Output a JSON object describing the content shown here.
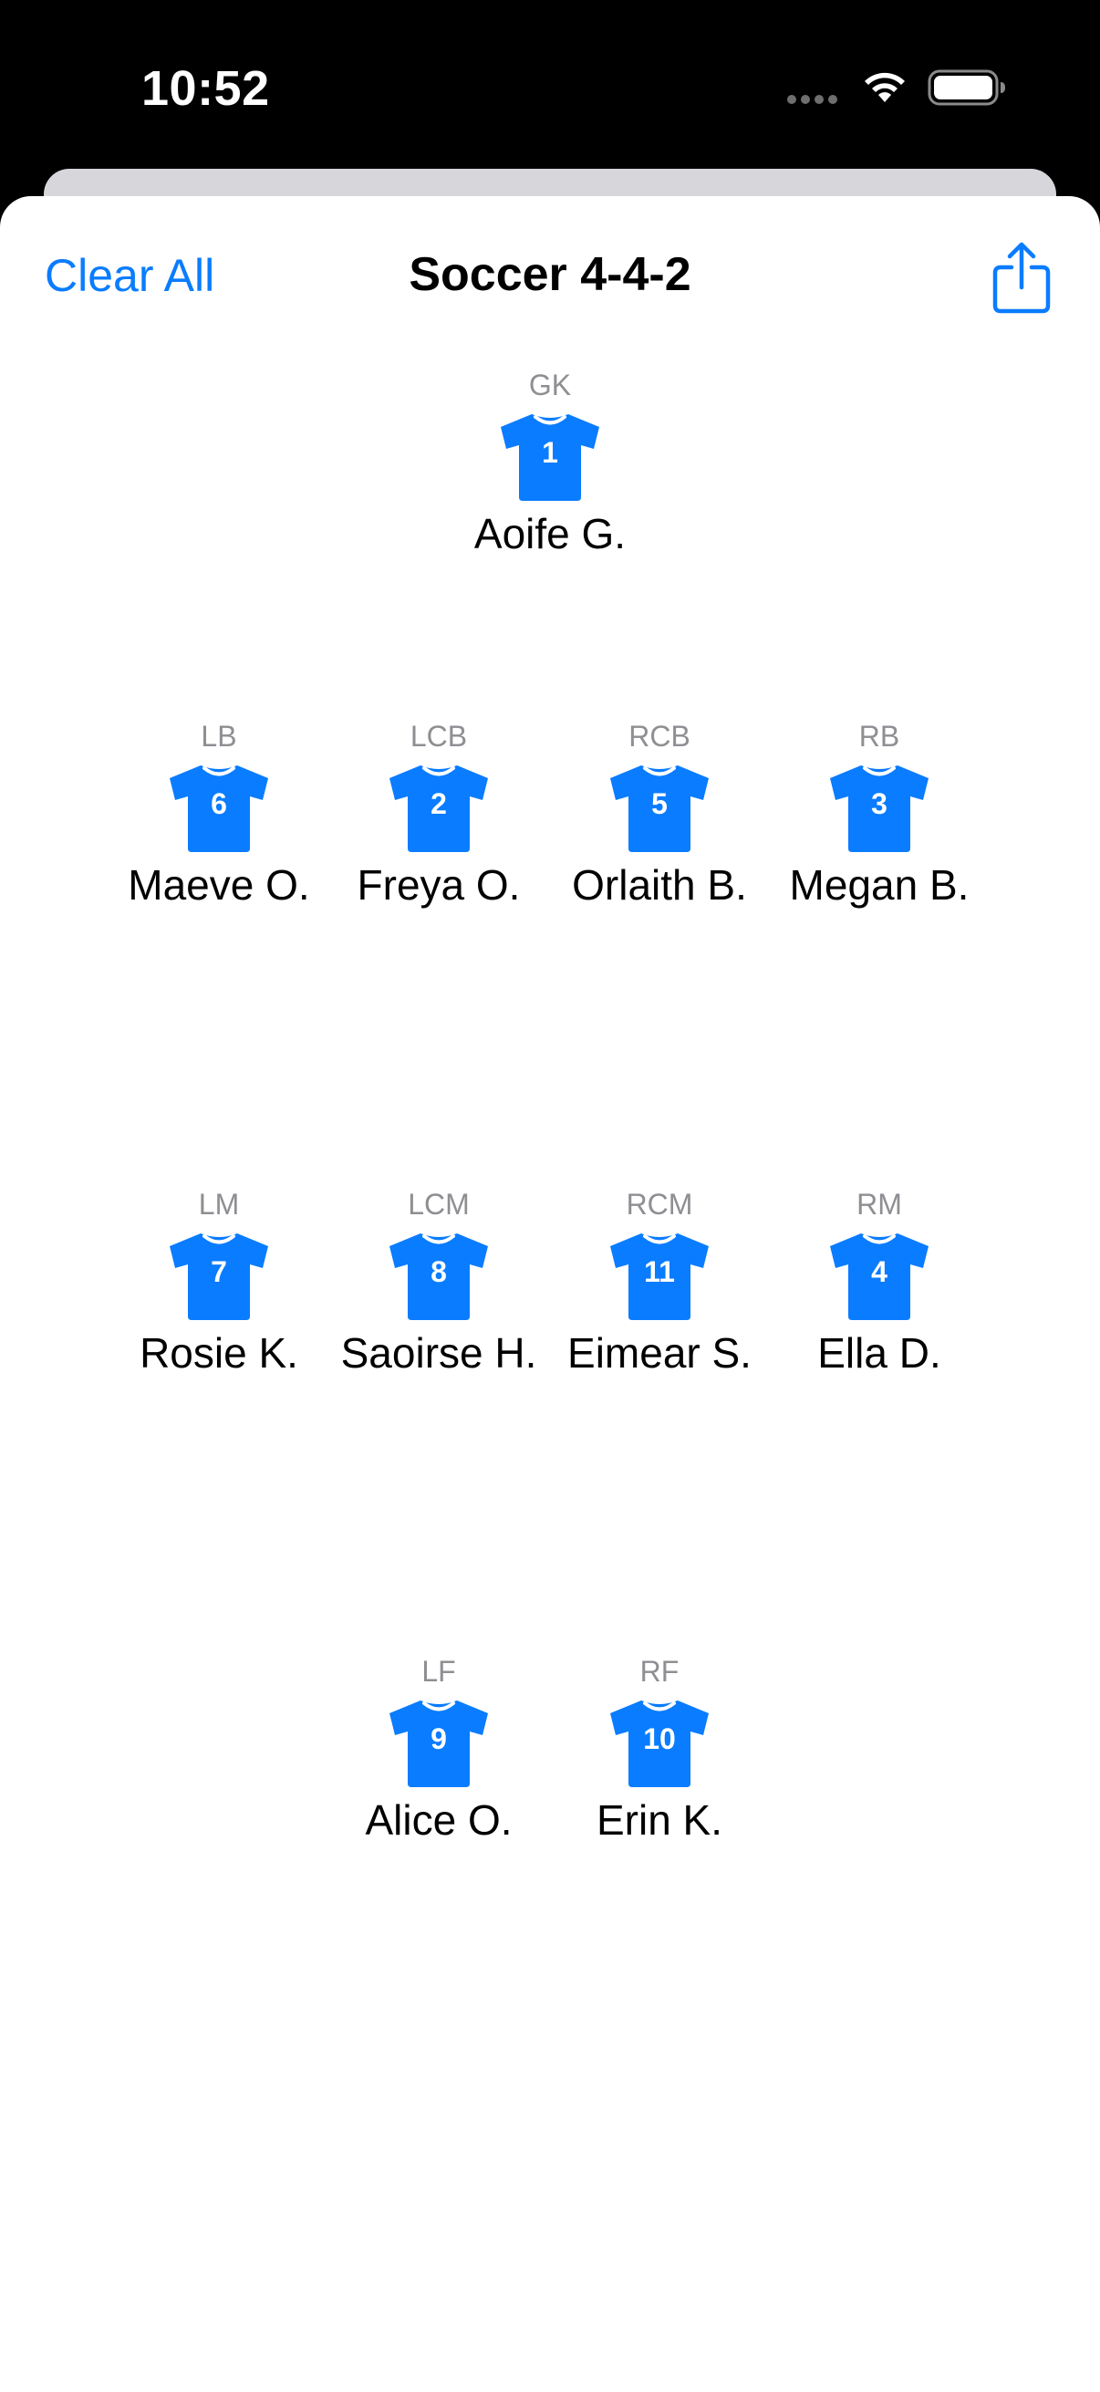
{
  "status_bar": {
    "time": "10:52"
  },
  "nav": {
    "clear_label": "Clear All",
    "title": "Soccer 4-4-2",
    "share_icon": "share-icon"
  },
  "colors": {
    "accent": "#0a7cff",
    "jersey": "#0a7cff",
    "position_label": "#8e8e93"
  },
  "players": {
    "gk": {
      "position": "GK",
      "number": "1",
      "name": "Aoife G."
    },
    "lb": {
      "position": "LB",
      "number": "6",
      "name": "Maeve O."
    },
    "lcb": {
      "position": "LCB",
      "number": "2",
      "name": "Freya O."
    },
    "rcb": {
      "position": "RCB",
      "number": "5",
      "name": "Orlaith B."
    },
    "rb": {
      "position": "RB",
      "number": "3",
      "name": "Megan B."
    },
    "lm": {
      "position": "LM",
      "number": "7",
      "name": "Rosie K."
    },
    "lcm": {
      "position": "LCM",
      "number": "8",
      "name": "Saoirse H."
    },
    "rcm": {
      "position": "RCM",
      "number": "11",
      "name": "Eimear S."
    },
    "rm": {
      "position": "RM",
      "number": "4",
      "name": "Ella D."
    },
    "lf": {
      "position": "LF",
      "number": "9",
      "name": "Alice O."
    },
    "rf": {
      "position": "RF",
      "number": "10",
      "name": "Erin K."
    }
  }
}
